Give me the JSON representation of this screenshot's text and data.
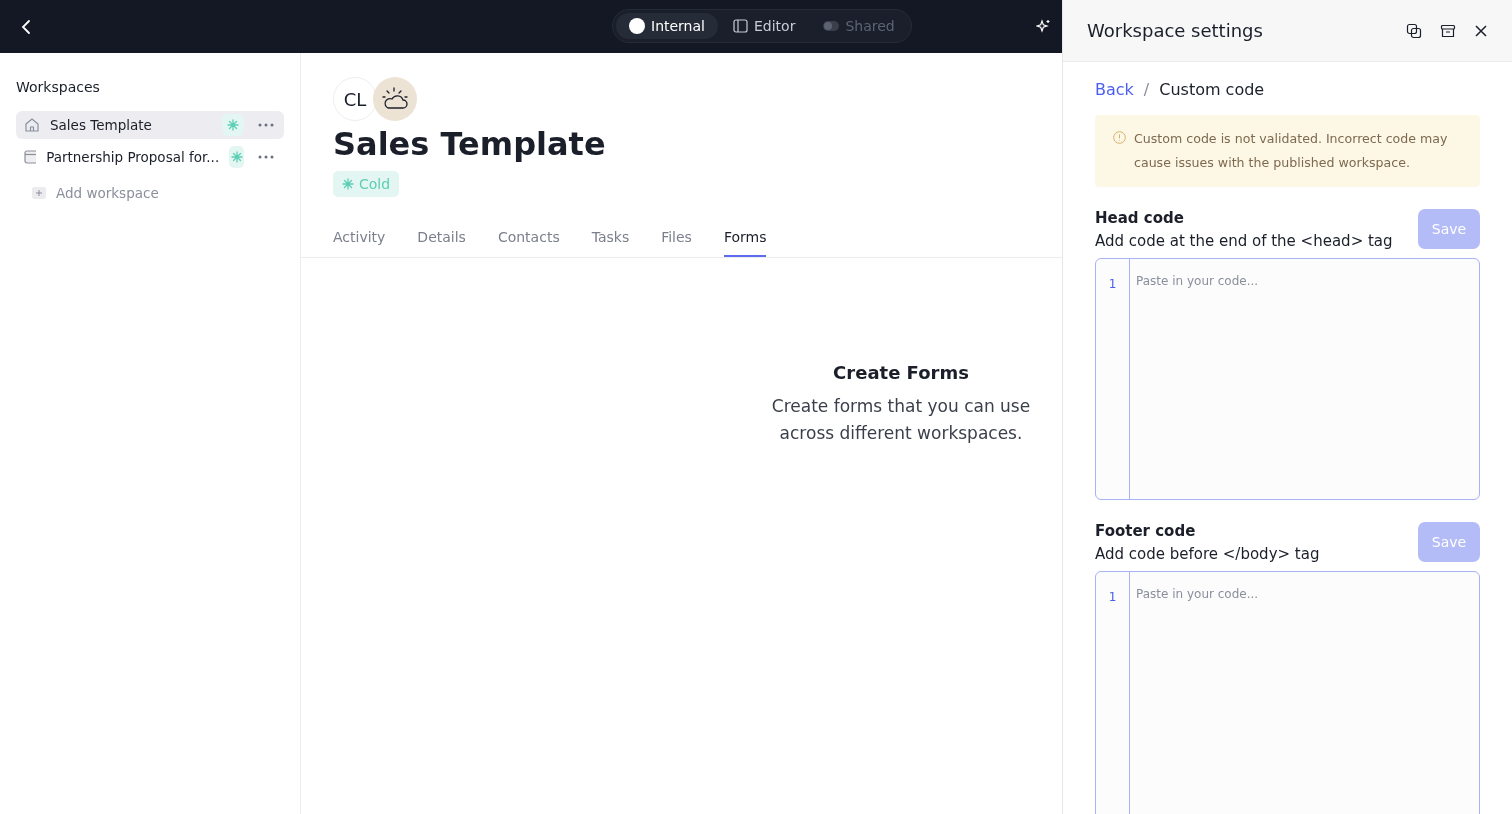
{
  "top_bar": {
    "modes": [
      {
        "label": "Internal",
        "kind": "dot",
        "selected": true,
        "disabled": false
      },
      {
        "label": "Editor",
        "kind": "panel",
        "selected": false,
        "disabled": false
      },
      {
        "label": "Shared",
        "kind": "toggle",
        "selected": false,
        "disabled": true
      }
    ]
  },
  "sidebar": {
    "title": "Workspaces",
    "items": [
      {
        "label": "Sales Template",
        "kind": "home",
        "selected": true
      },
      {
        "label": "Partnership Proposal for...",
        "kind": "window",
        "selected": false
      }
    ],
    "add_label": "Add workspace"
  },
  "workspace": {
    "avatar_initials": "CL",
    "title": "Sales Template",
    "tag": "Cold",
    "tabs": [
      {
        "label": "Activity",
        "selected": false
      },
      {
        "label": "Details",
        "selected": false
      },
      {
        "label": "Contacts",
        "selected": false
      },
      {
        "label": "Tasks",
        "selected": false
      },
      {
        "label": "Files",
        "selected": false
      },
      {
        "label": "Forms",
        "selected": true
      }
    ],
    "empty_state": {
      "title": "Create Forms",
      "text": "Create forms that you can use across different workspaces."
    }
  },
  "settings_panel": {
    "title": "Workspace settings",
    "breadcrumb": {
      "back": "Back",
      "separator": "/",
      "current": "Custom code"
    },
    "warning": "Custom code is not validated. Incorrect code may cause issues with the published workspace.",
    "sections": [
      {
        "title": "Head code",
        "description": "Add code at the end of the <head> tag",
        "button": "Save",
        "disabled": true,
        "line_number": "1",
        "placeholder": "Paste in your code..."
      },
      {
        "title": "Footer code",
        "description": "Add code before </body> tag",
        "button": "Save",
        "disabled": true,
        "line_number": "1",
        "placeholder": "Paste in your code..."
      }
    ]
  }
}
